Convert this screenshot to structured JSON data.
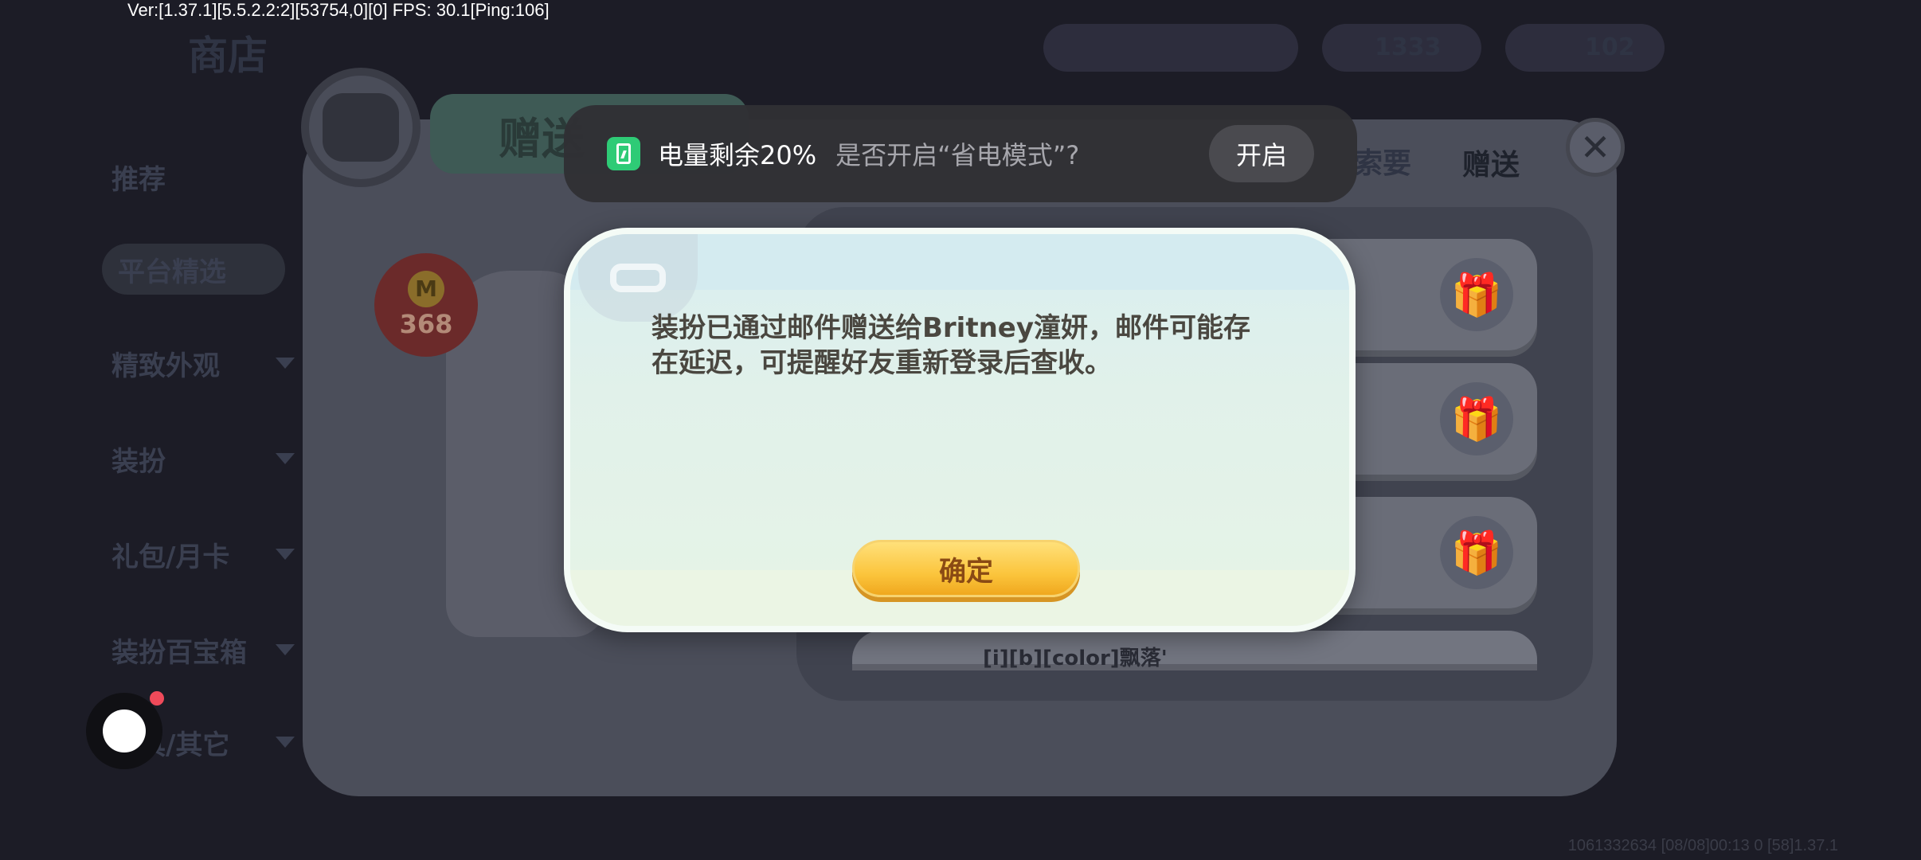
{
  "debug": {
    "version_line": "Ver:[1.37.1][5.5.2.2:2][53754,0][0] FPS: 30.1[Ping:106]",
    "bottom_info": "1061332634    [08/08]00:13 0  [58]1.37.1"
  },
  "background": {
    "shop_title": "商店",
    "send_tab_title": "赠送",
    "tabs": {
      "request": "索要",
      "send": "赠送"
    },
    "sidebar": [
      {
        "label": "推荐"
      },
      {
        "label": "平台精选"
      },
      {
        "label": "精致外观"
      },
      {
        "label": "装扮"
      },
      {
        "label": "礼包/月卡"
      },
      {
        "label": "装扮百宝箱"
      },
      {
        "label": "道具/其它"
      }
    ],
    "price_badge": {
      "icon_letter": "M",
      "value": "368"
    },
    "list_item_name": "[i][b][color]飘落'",
    "currency_amount": "1333",
    "currency_amount_2": "102"
  },
  "battery_toast": {
    "level_text": "电量剩余20%",
    "question_text": "是否开启“省电模式”?",
    "enable_label": "开启",
    "icon_color": "#2ecb76"
  },
  "dialog": {
    "message": "装扮已通过邮件赠送给Britney潼妍，邮件可能存在延迟，可提醒好友重新登录后查收。",
    "confirm_label": "确定"
  },
  "float_button": {
    "badge_color": "#ef4a5a"
  }
}
